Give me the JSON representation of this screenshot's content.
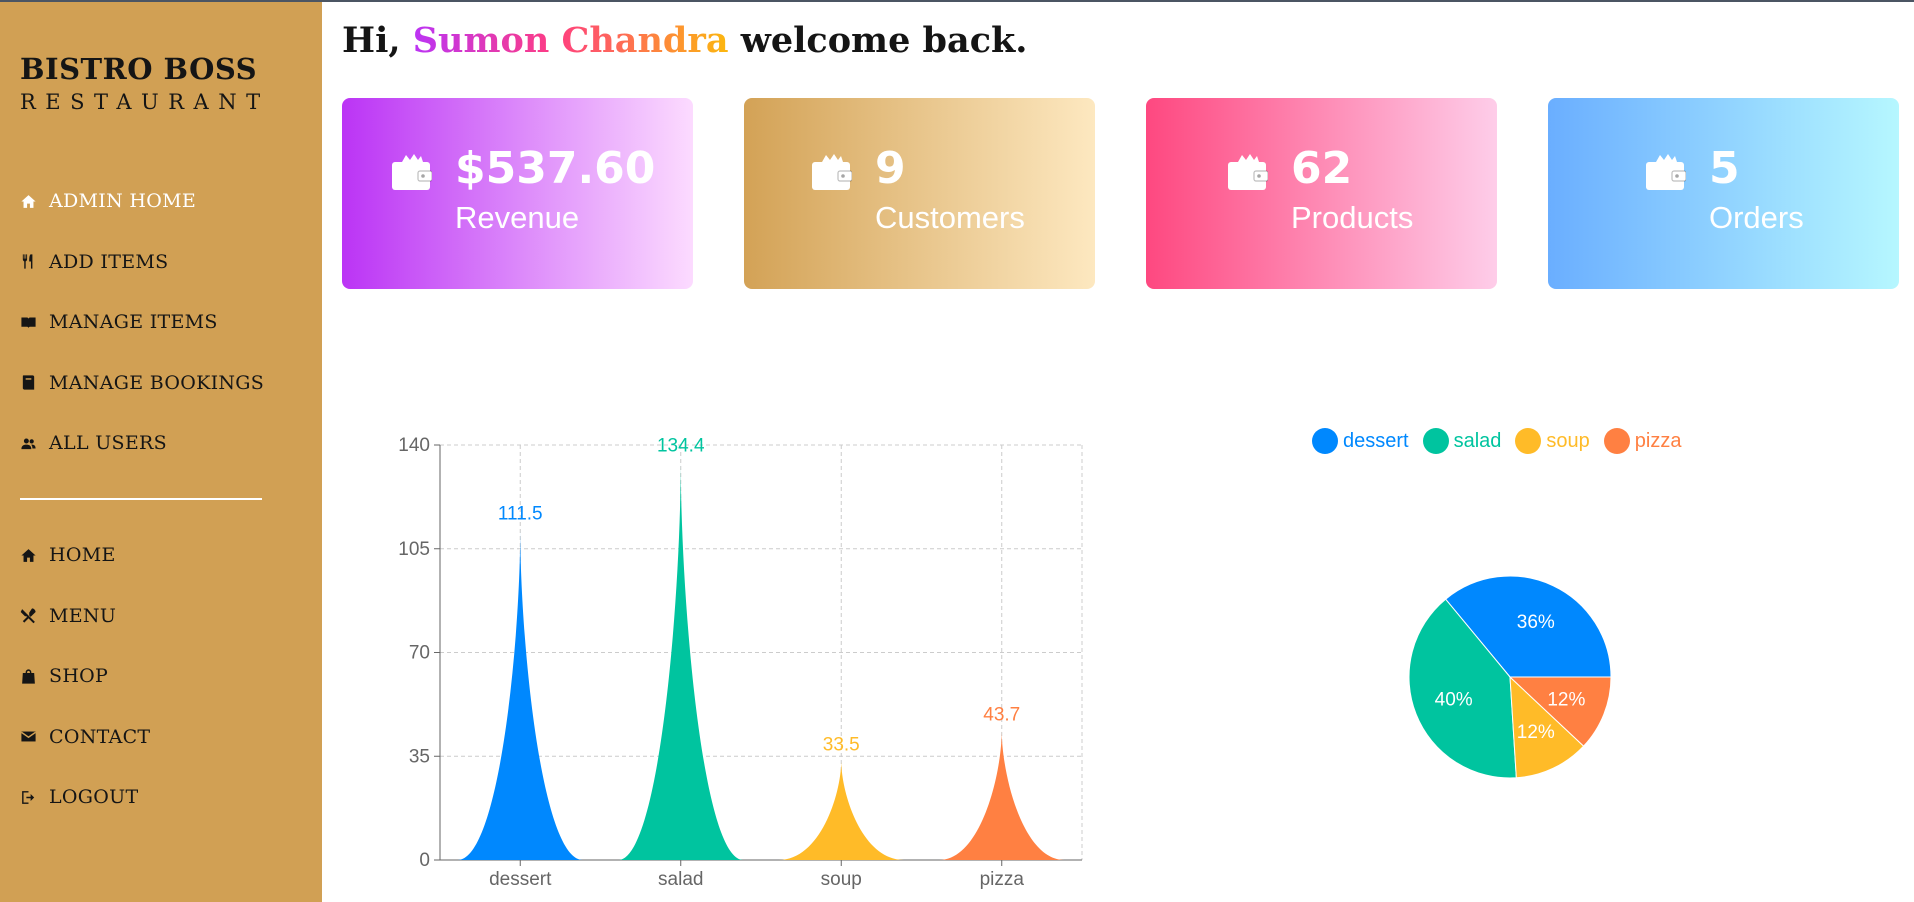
{
  "sidebar": {
    "brand_title": "BISTRO BOSS",
    "brand_subtitle": "RESTAURANT",
    "primary_items": [
      {
        "label": "ADMIN HOME",
        "icon": "home-icon",
        "active": true
      },
      {
        "label": "ADD ITEMS",
        "icon": "utensils-icon",
        "active": false
      },
      {
        "label": "MANAGE ITEMS",
        "icon": "book-icon",
        "active": false
      },
      {
        "label": "MANAGE BOOKINGS",
        "icon": "booking-icon",
        "active": false
      },
      {
        "label": "ALL USERS",
        "icon": "users-icon",
        "active": false
      }
    ],
    "secondary_items": [
      {
        "label": "HOME",
        "icon": "home-icon"
      },
      {
        "label": "MENU",
        "icon": "cutlery-icon"
      },
      {
        "label": "SHOP",
        "icon": "shopping-bag-icon"
      },
      {
        "label": "CONTACT",
        "icon": "envelope-icon"
      },
      {
        "label": "LOGOUT",
        "icon": "logout-icon"
      }
    ]
  },
  "header": {
    "greeting_prefix": "Hi,",
    "user_name": "Sumon Chandra",
    "greeting_suffix": "welcome back."
  },
  "stats": [
    {
      "value": "$537.60",
      "label": "Revenue",
      "icon": "wallet-icon",
      "gradient": [
        "#bb34f5",
        "#fcdbff"
      ]
    },
    {
      "value": "9",
      "label": "Customers",
      "icon": "wallet-icon",
      "gradient": [
        "#d3a256",
        "#fde8c0"
      ]
    },
    {
      "value": "62",
      "label": "Products",
      "icon": "wallet-icon",
      "gradient": [
        "#fe4880",
        "#fecde9"
      ]
    },
    {
      "value": "5",
      "label": "Orders",
      "icon": "wallet-icon",
      "gradient": [
        "#6aaeff",
        "#b6f7ff"
      ]
    }
  ],
  "colors": {
    "sidebar_bg": "#d1a054",
    "dessert": "#0088fe",
    "salad": "#00c49f",
    "soup": "#ffbb28",
    "pizza": "#ff8042"
  },
  "chart_data": [
    {
      "type": "bar",
      "categories": [
        "dessert",
        "salad",
        "soup",
        "pizza"
      ],
      "values": [
        111.5,
        134.4,
        33.5,
        43.7
      ],
      "ylim": [
        0,
        140
      ],
      "yticks": [
        0,
        35,
        70,
        105,
        140
      ],
      "grid": true,
      "colors": [
        "#0088fe",
        "#00c49f",
        "#ffbb28",
        "#ff8042"
      ]
    },
    {
      "type": "pie",
      "categories": [
        "dessert",
        "salad",
        "soup",
        "pizza"
      ],
      "values": [
        36,
        40,
        12,
        12
      ],
      "labels": [
        "36%",
        "40%",
        "12%",
        "12%"
      ],
      "legend": "top",
      "colors": [
        "#0088fe",
        "#00c49f",
        "#ffbb28",
        "#ff8042"
      ]
    }
  ]
}
